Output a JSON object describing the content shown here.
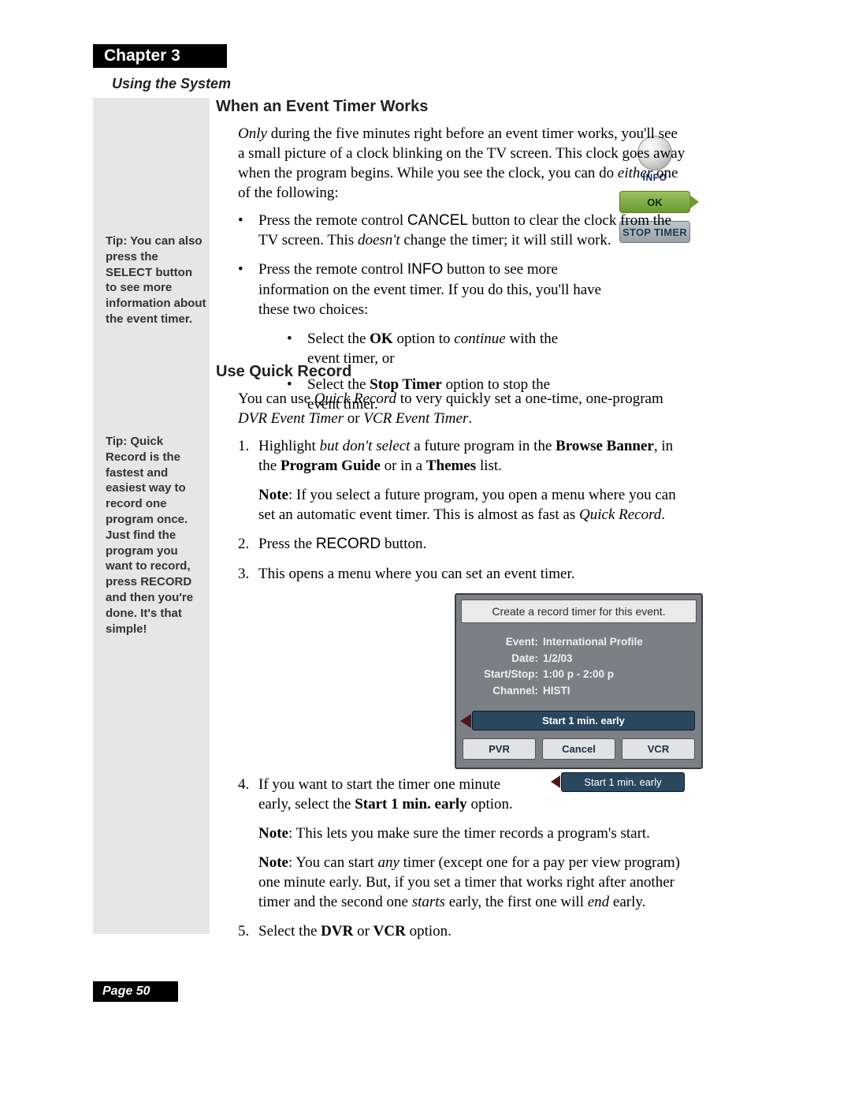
{
  "chapter_label": "Chapter 3",
  "subtitle": "Using the System",
  "page_label": "Page 50",
  "tip1": "Tip: You can also press the SELECT button to see more information about the event timer.",
  "tip2": "Tip: Quick Record is the fastest and easiest way to record one program once. Just find the program you want to record, press RECORD and then you're done. It's that simple!",
  "s1": {
    "heading": "When an Event Timer Works",
    "intro_html": "<i>Only</i> during the five minutes right before an event timer works, you'll see a small picture of a clock blinking on the TV screen. This clock goes away when the program begins. While you see the clock, you can do <i>either</i> one of the following:",
    "bul1_html": "Press the remote control <span class=\"sans\">CANCEL</span> button to clear the clock from the TV screen. This <i>doesn't</i> change the timer; it will still work.",
    "bul2_html": "Press the remote control <span class=\"sans\">INFO</span> button to see more information on the event timer. If you do this, you'll have these two choices:",
    "sub1_html": "Select the <b>OK</b> option to <i>continue</i> with the event timer, or",
    "sub2_html": "Select the <b>Stop Timer</b> option to stop the event timer."
  },
  "info_widget": {
    "label": "INFO",
    "ok": "OK",
    "stop": "STOP TIMER"
  },
  "s2": {
    "heading": "Use Quick Record",
    "intro_html": "You can use <i>Quick Record</i> to very quickly set a one-time, one-program <i>DVR Event Timer</i> or <i>VCR Event Timer</i>.",
    "li1_html": "Highlight <i>but don't select</i> a future program in the <b>Browse Banner</b>, in the <b>Program Guide</b> or in a <b>Themes</b> list.",
    "li1_note_html": "<b>Note</b>: If you select a future program, you open a menu where you can set an automatic event timer. This is almost as fast as <i>Quick Record</i>.",
    "li2_html": "Press the <span class=\"sans\">RECORD</span> button.",
    "li3_html": "This opens a menu where you can set an event timer.",
    "li4_html": "If you want to start the timer one minute early, select the <b>Start 1 min. early</b> option.",
    "li4_note1_html": "<b>Note</b>: This lets you make sure the timer records a program's start.",
    "li4_note2_html": "<b>Note</b>: You can start <i>any</i> timer (except one for a pay per view program) one minute early. But, if you set a timer that works right after another timer and the second one <i>starts</i> early, the first one will <i>end</i> early.",
    "li5_html": "Select the <b>DVR</b> or <b>VCR</b> option."
  },
  "dialog": {
    "title": "Create a record timer for this event.",
    "fields": {
      "event_label": "Event:",
      "event_value": "International Profile",
      "date_label": "Date:",
      "date_value": "1/2/03",
      "startstop_label": "Start/Stop:",
      "startstop_value": "1:00 p - 2:00 p",
      "channel_label": "Channel:",
      "channel_value": "HISTI"
    },
    "early": "Start 1 min. early",
    "btn_pvr": "PVR",
    "btn_cancel": "Cancel",
    "btn_vcr": "VCR"
  },
  "early_chip": "Start 1 min. early"
}
